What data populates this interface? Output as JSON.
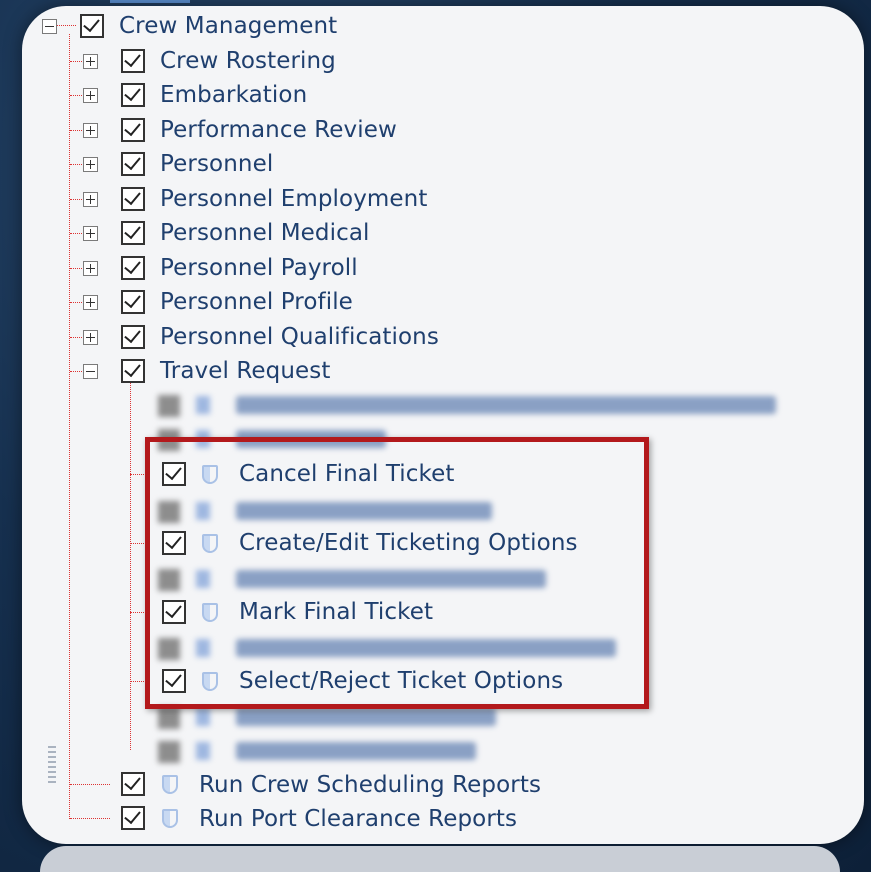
{
  "tree": {
    "root": {
      "label": "Crew Management",
      "checked": true,
      "expanded": true
    },
    "children": [
      {
        "label": "Crew Rostering",
        "checked": true
      },
      {
        "label": "Embarkation",
        "checked": true
      },
      {
        "label": "Performance Review",
        "checked": true
      },
      {
        "label": "Personnel",
        "checked": true
      },
      {
        "label": "Personnel Employment",
        "checked": true
      },
      {
        "label": "Personnel Medical",
        "checked": true
      },
      {
        "label": "Personnel Payroll",
        "checked": true
      },
      {
        "label": "Personnel Profile",
        "checked": true
      },
      {
        "label": "Personnel Qualifications",
        "checked": true
      }
    ],
    "travel_request": {
      "label": "Travel Request",
      "checked": true,
      "expanded": true,
      "permissions": [
        {
          "label": "Cancel Final Ticket",
          "checked": true
        },
        {
          "label": "Create/Edit Ticketing Options",
          "checked": true
        },
        {
          "label": "Mark Final Ticket",
          "checked": true
        },
        {
          "label": "Select/Reject Ticket Options",
          "checked": true
        }
      ]
    },
    "reports": [
      {
        "label": "Run Crew Scheduling Reports",
        "checked": true
      },
      {
        "label": "Run Port Clearance Reports",
        "checked": true
      }
    ]
  },
  "colors": {
    "label_text": "#1f3f6e",
    "highlight_border": "#b3191c",
    "connector_lines": "#dd3333",
    "panel_bg": "#f4f5f7"
  },
  "icons": {
    "permission": "shield-icon",
    "expand": "plus-expander-icon",
    "collapse": "minus-expander-icon"
  }
}
